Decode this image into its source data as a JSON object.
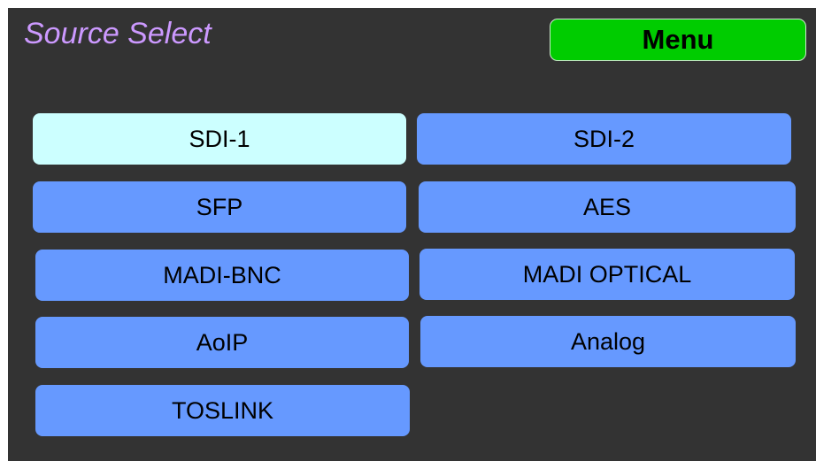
{
  "header": {
    "title": "Source Select",
    "menu_label": "Menu"
  },
  "colors": {
    "background": "#333333",
    "title": "#cc99ff",
    "menu_button": "#00cc00",
    "source_button": "#6699ff",
    "source_button_selected": "#ccffff"
  },
  "sources": {
    "selected": "SDI-1",
    "items": [
      {
        "label": "SDI-1"
      },
      {
        "label": "SDI-2"
      },
      {
        "label": "SFP"
      },
      {
        "label": "AES"
      },
      {
        "label": "MADI-BNC"
      },
      {
        "label": "MADI OPTICAL"
      },
      {
        "label": "AoIP"
      },
      {
        "label": "Analog"
      },
      {
        "label": "TOSLINK"
      }
    ]
  }
}
